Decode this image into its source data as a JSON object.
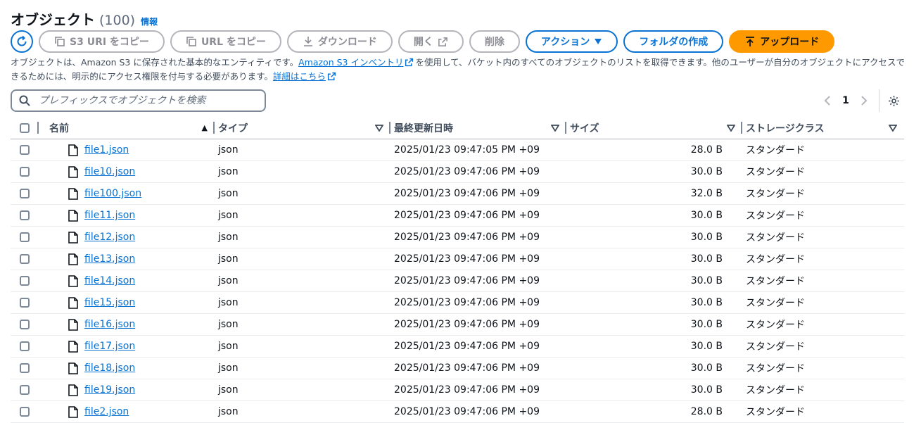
{
  "header": {
    "title": "オブジェクト",
    "count": "(100)",
    "info": "情報"
  },
  "toolbar": {
    "copy_s3_uri": "S3 URI をコピー",
    "copy_url": "URL をコピー",
    "download": "ダウンロード",
    "open": "開く",
    "delete": "削除",
    "actions": "アクション",
    "create_folder": "フォルダの作成",
    "upload": "アップロード"
  },
  "description": {
    "part1": "オブジェクトは、Amazon S3 に保存された基本的なエンティティです。",
    "link1": "Amazon S3 インベントリ",
    "part2": "を使用して、バケット内のすべてのオブジェクトのリストを取得できます。他のユーザーが自分のオブジェクトにアクセスできるためには、明示的にアクセス権限を付与する必要があります。",
    "link2": "詳細はこちら"
  },
  "search": {
    "placeholder": "プレフィックスでオブジェクトを検索"
  },
  "pagination": {
    "current_page": "1"
  },
  "table": {
    "columns": {
      "name": "名前",
      "type": "タイプ",
      "modified": "最終更新日時",
      "size": "サイズ",
      "storage_class": "ストレージクラス"
    },
    "rows": [
      {
        "name": "file1.json",
        "type": "json",
        "modified": "2025/01/23 09:47:05 PM +09",
        "size": "28.0 B",
        "storage_class": "スタンダード"
      },
      {
        "name": "file10.json",
        "type": "json",
        "modified": "2025/01/23 09:47:06 PM +09",
        "size": "30.0 B",
        "storage_class": "スタンダード"
      },
      {
        "name": "file100.json",
        "type": "json",
        "modified": "2025/01/23 09:47:06 PM +09",
        "size": "32.0 B",
        "storage_class": "スタンダード"
      },
      {
        "name": "file11.json",
        "type": "json",
        "modified": "2025/01/23 09:47:06 PM +09",
        "size": "30.0 B",
        "storage_class": "スタンダード"
      },
      {
        "name": "file12.json",
        "type": "json",
        "modified": "2025/01/23 09:47:06 PM +09",
        "size": "30.0 B",
        "storage_class": "スタンダード"
      },
      {
        "name": "file13.json",
        "type": "json",
        "modified": "2025/01/23 09:47:06 PM +09",
        "size": "30.0 B",
        "storage_class": "スタンダード"
      },
      {
        "name": "file14.json",
        "type": "json",
        "modified": "2025/01/23 09:47:06 PM +09",
        "size": "30.0 B",
        "storage_class": "スタンダード"
      },
      {
        "name": "file15.json",
        "type": "json",
        "modified": "2025/01/23 09:47:06 PM +09",
        "size": "30.0 B",
        "storage_class": "スタンダード"
      },
      {
        "name": "file16.json",
        "type": "json",
        "modified": "2025/01/23 09:47:06 PM +09",
        "size": "30.0 B",
        "storage_class": "スタンダード"
      },
      {
        "name": "file17.json",
        "type": "json",
        "modified": "2025/01/23 09:47:06 PM +09",
        "size": "30.0 B",
        "storage_class": "スタンダード"
      },
      {
        "name": "file18.json",
        "type": "json",
        "modified": "2025/01/23 09:47:06 PM +09",
        "size": "30.0 B",
        "storage_class": "スタンダード"
      },
      {
        "name": "file19.json",
        "type": "json",
        "modified": "2025/01/23 09:47:06 PM +09",
        "size": "30.0 B",
        "storage_class": "スタンダード"
      },
      {
        "name": "file2.json",
        "type": "json",
        "modified": "2025/01/23 09:47:06 PM +09",
        "size": "28.0 B",
        "storage_class": "スタンダード"
      }
    ]
  },
  "colors": {
    "link": "#0972d3",
    "primary": "#ff9900",
    "disabled": "#8c8c94"
  }
}
